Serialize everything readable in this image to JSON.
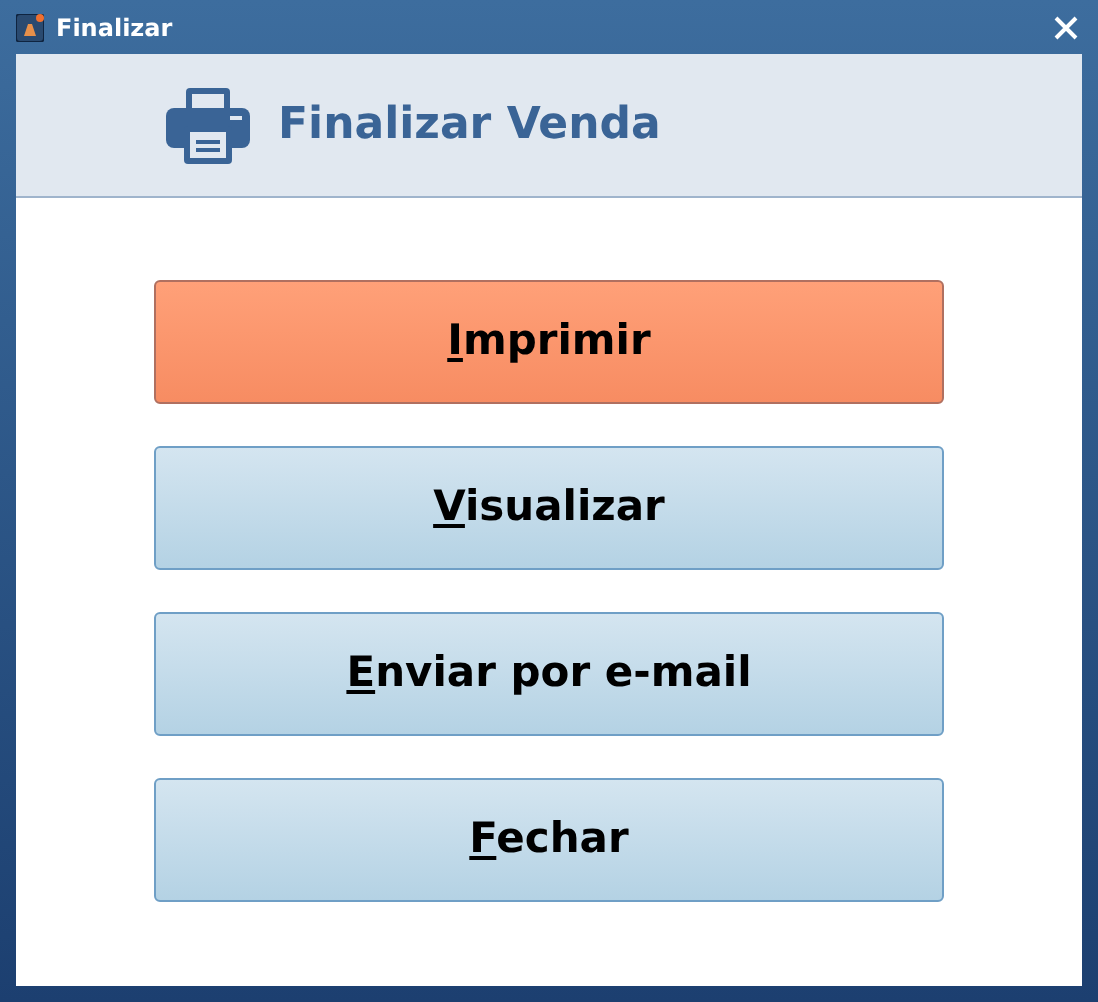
{
  "window": {
    "title": "Finalizar"
  },
  "header": {
    "title": "Finalizar Venda"
  },
  "buttons": [
    {
      "label": "Imprimir",
      "focused": true
    },
    {
      "label": "Visualizar",
      "focused": false
    },
    {
      "label": "Enviar por e-mail",
      "focused": false
    },
    {
      "label": "Fechar",
      "focused": false
    }
  ]
}
